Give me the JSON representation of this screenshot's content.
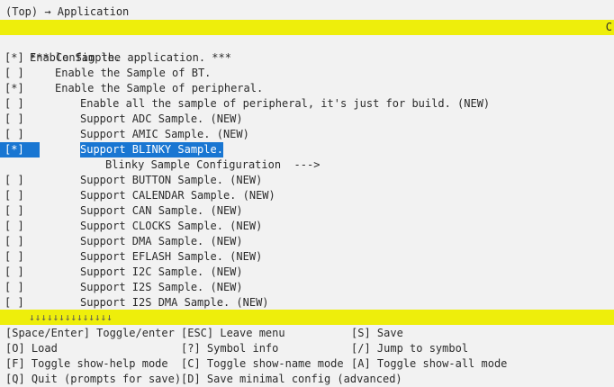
{
  "breadcrumb": "(Top) → Application",
  "top_bar_marker": "C",
  "bottom_bar_arrows": "↓↓↓↓↓↓↓↓↓↓↓↓↓↓",
  "menu": {
    "header": "*** Config the application. ***",
    "items": [
      {
        "check": "[*]",
        "label": "Enable Sample.",
        "indent": 0
      },
      {
        "check": "[ ]",
        "label": "Enable the Sample of BT.",
        "indent": 1
      },
      {
        "check": "[*]",
        "label": "Enable the Sample of peripheral.",
        "indent": 1
      },
      {
        "check": "[ ]",
        "label": "Enable all the sample of peripheral, it's just for build. (NEW)",
        "indent": 2
      },
      {
        "check": "[ ]",
        "label": "Support ADC Sample. (NEW)",
        "indent": 2
      },
      {
        "check": "[ ]",
        "label": "Support AMIC Sample. (NEW)",
        "indent": 2
      },
      {
        "check": "[*]",
        "label": "Support BLINKY Sample.",
        "indent": 2,
        "selected": true
      },
      {
        "check": "",
        "label": "Blinky Sample Configuration  --->",
        "indent": 3
      },
      {
        "check": "[ ]",
        "label": "Support BUTTON Sample. (NEW)",
        "indent": 2
      },
      {
        "check": "[ ]",
        "label": "Support CALENDAR Sample. (NEW)",
        "indent": 2
      },
      {
        "check": "[ ]",
        "label": "Support CAN Sample. (NEW)",
        "indent": 2
      },
      {
        "check": "[ ]",
        "label": "Support CLOCKS Sample. (NEW)",
        "indent": 2
      },
      {
        "check": "[ ]",
        "label": "Support DMA Sample. (NEW)",
        "indent": 2
      },
      {
        "check": "[ ]",
        "label": "Support EFLASH Sample. (NEW)",
        "indent": 2
      },
      {
        "check": "[ ]",
        "label": "Support I2C Sample. (NEW)",
        "indent": 2
      },
      {
        "check": "[ ]",
        "label": "Support I2S Sample. (NEW)",
        "indent": 2
      },
      {
        "check": "[ ]",
        "label": "Support I2S DMA Sample. (NEW)",
        "indent": 2
      }
    ]
  },
  "help": [
    [
      "[Space/Enter] Toggle/enter",
      "[ESC] Leave menu",
      "[S] Save"
    ],
    [
      "[O] Load",
      "[?] Symbol info",
      "[/] Jump to symbol"
    ],
    [
      "[F] Toggle show-help mode",
      "[C] Toggle show-name mode",
      "[A] Toggle show-all mode"
    ],
    [
      "[Q] Quit (prompts for save)",
      "[D] Save minimal config (advanced)",
      ""
    ]
  ],
  "colors": {
    "bar": "#eeee0b",
    "selection": "#1976d2",
    "background": "#f2f2f2",
    "text": "#2b2b2b"
  }
}
